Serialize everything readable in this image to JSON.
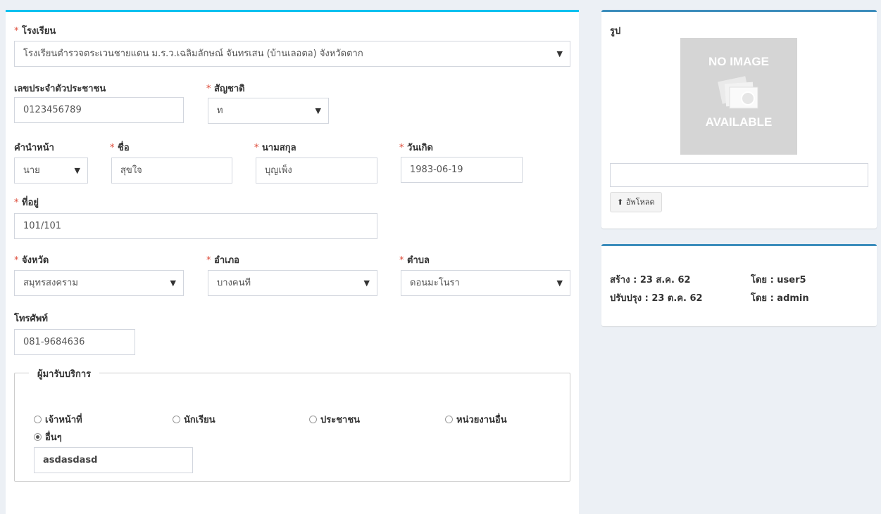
{
  "form": {
    "school": {
      "label": "โรงเรียน",
      "value": "โรงเรียนตำรวจตระเวนชายแดน ม.ร.ว.เฉลิมลักษณ์ จันทรเสน (บ้านเลอตอ) จังหวัดตาก"
    },
    "citizen_id": {
      "label": "เลขประจำตัวประชาชน",
      "value": "0123456789"
    },
    "nationality": {
      "label": "สัญชาติ",
      "value": "ท"
    },
    "prefix": {
      "label": "คำนำหน้า",
      "value": "นาย"
    },
    "first_name": {
      "label": "ชื่อ",
      "value": "สุขใจ"
    },
    "last_name": {
      "label": "นามสกุล",
      "value": "บุญเพ็ง"
    },
    "birthdate": {
      "label": "วันเกิด",
      "value": "1983-06-19"
    },
    "address": {
      "label": "ที่อยู่",
      "value": "101/101"
    },
    "province": {
      "label": "จังหวัด",
      "value": "สมุทรสงคราม"
    },
    "district": {
      "label": "อำเภอ",
      "value": "บางคนที"
    },
    "subdistrict": {
      "label": "ตำบล",
      "value": "ดอนมะโนรา"
    },
    "phone": {
      "label": "โทรศัพท์",
      "value": "081-9684636"
    },
    "required_mark": "*",
    "dropdown_arrow": "▼",
    "service_group": {
      "legend": "ผู้มารับบริการ",
      "options": [
        "เจ้าหน้าที่",
        "นักเรียน",
        "ประชาชน",
        "หน่วยงานอื่น",
        "อื่นๆ"
      ],
      "selected": "อื่นๆ",
      "other_value": "asdasdasd"
    }
  },
  "photo": {
    "label": "รูป",
    "placeholder_top": "NO IMAGE",
    "placeholder_bottom": "AVAILABLE",
    "file_value": "",
    "upload_label": "อัพโหลด",
    "upload_icon": "upload-icon"
  },
  "audit": {
    "created": "สร้าง : 23 ส.ค. 62",
    "created_by": "โดย : user5",
    "updated": "ปรับปรุง : 23 ต.ค. 62",
    "updated_by": "โดย : admin"
  },
  "colors": {
    "accent_main": "#00c0ef",
    "accent_side": "#3c8dbc",
    "required": "#dd4b39"
  }
}
